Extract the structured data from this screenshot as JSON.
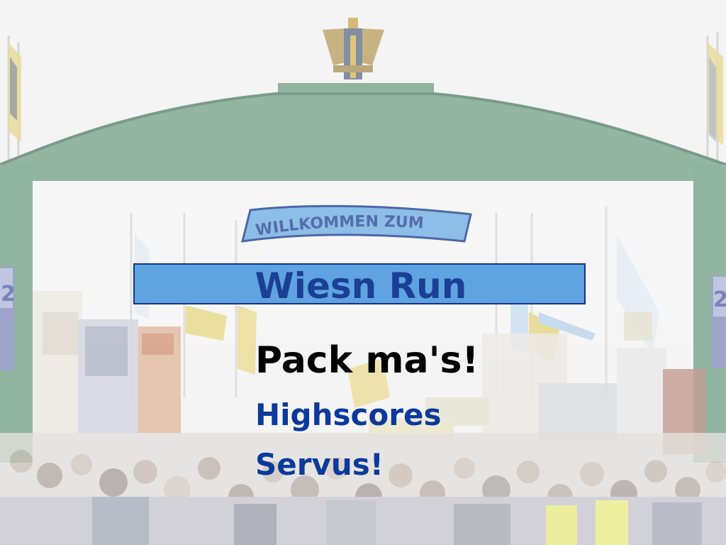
{
  "scene": {
    "arch_sign_text": "WILLKOMMEN ZUM",
    "left_pillar_number": "2",
    "right_pillar_number": "2"
  },
  "title": "Wiesn Run",
  "menu": {
    "start": "Pack ma's!",
    "highscores": "Highscores",
    "quit": "Servus!"
  },
  "colors": {
    "menu_selected": "#000000",
    "menu_default": "#0b3a9c",
    "banner_fill": "#5fa3e0",
    "banner_border": "#12348a",
    "title_text": "#1a3f94"
  }
}
